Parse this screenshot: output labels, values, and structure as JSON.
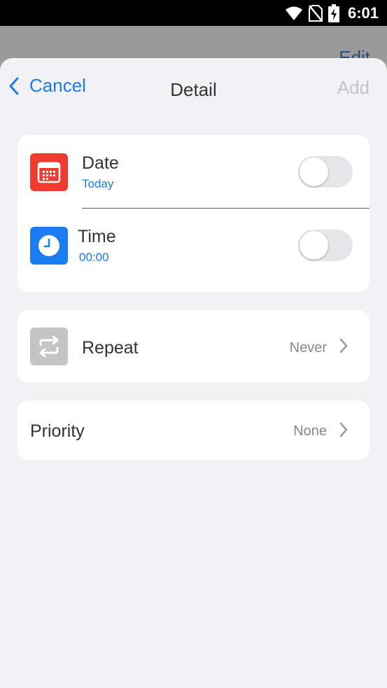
{
  "status_bar": {
    "time": "6:01",
    "icons": [
      "wifi-icon",
      "no-sim-icon",
      "battery-charging-icon"
    ]
  },
  "background": {
    "edit_label": "Edit"
  },
  "nav": {
    "cancel_label": "Cancel",
    "title": "Detail",
    "add_label": "Add"
  },
  "datetime_card": {
    "date": {
      "title": "Date",
      "value": "Today",
      "icon": "calendar-icon",
      "toggle_on": false
    },
    "time": {
      "title": "Time",
      "value": "00:00",
      "icon": "clock-icon",
      "toggle_on": false
    }
  },
  "repeat_card": {
    "title": "Repeat",
    "value": "Never",
    "icon": "repeat-icon"
  },
  "priority_card": {
    "title": "Priority",
    "value": "None"
  },
  "colors": {
    "accent": "#1a7cf0",
    "calendar_red": "#f03c30",
    "clock_blue": "#1a7cf0",
    "repeat_gray": "#c4c4c6",
    "sheet_bg": "#f2f2f4"
  }
}
